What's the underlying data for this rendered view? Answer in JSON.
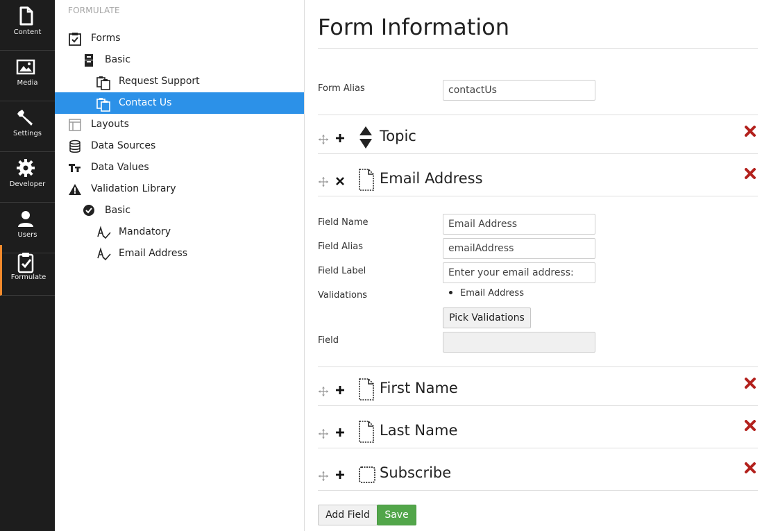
{
  "rail": {
    "items": [
      {
        "label": "Content",
        "icon": "document-icon"
      },
      {
        "label": "Media",
        "icon": "image-icon"
      },
      {
        "label": "Settings",
        "icon": "wrench-icon"
      },
      {
        "label": "Developer",
        "icon": "gear-icon"
      },
      {
        "label": "Users",
        "icon": "user-icon"
      },
      {
        "label": "Formulate",
        "icon": "clipboard-check-icon",
        "active": true
      }
    ]
  },
  "tree": {
    "title": "FORMULATE",
    "items": [
      {
        "label": "Forms",
        "icon": "clipboard-check-icon"
      },
      {
        "label": "Basic",
        "icon": "file-cabinet-icon"
      },
      {
        "label": "Request Support",
        "icon": "form-icon"
      },
      {
        "label": "Contact Us",
        "icon": "form-icon",
        "selected": true
      },
      {
        "label": "Layouts",
        "icon": "layout-icon"
      },
      {
        "label": "Data Sources",
        "icon": "database-icon"
      },
      {
        "label": "Data Values",
        "icon": "text-size-icon"
      },
      {
        "label": "Validation Library",
        "icon": "warning-icon"
      },
      {
        "label": "Basic",
        "icon": "check-circle-icon"
      },
      {
        "label": "Mandatory",
        "icon": "validation-icon"
      },
      {
        "label": "Email Address",
        "icon": "validation-icon"
      }
    ]
  },
  "main": {
    "title": "Form Information",
    "form_alias_label": "Form Alias",
    "form_alias_value": "contactUs",
    "fields": [
      {
        "name": "Topic",
        "icon": "sort-icon",
        "expanded": false
      },
      {
        "name": "Email Address",
        "icon": "text-field-icon",
        "expanded": true
      },
      {
        "name": "First Name",
        "icon": "text-field-icon",
        "expanded": false
      },
      {
        "name": "Last Name",
        "icon": "text-field-icon",
        "expanded": false
      },
      {
        "name": "Subscribe",
        "icon": "checkbox-icon",
        "expanded": false
      }
    ],
    "expanded_field": {
      "field_name_label": "Field Name",
      "field_name_value": "Email Address",
      "field_alias_label": "Field Alias",
      "field_alias_value": "emailAddress",
      "field_label_label": "Field Label",
      "field_label_value": "Enter your email address:",
      "validations_label": "Validations",
      "validations": [
        "Email Address"
      ],
      "pick_validations_label": "Pick Validations",
      "field_label": "Field",
      "field_value": ""
    },
    "add_field_label": "Add Field",
    "save_label": "Save"
  },
  "colors": {
    "rail_bg": "#1d1d1d",
    "rail_active_accent": "#f58a2c",
    "selected_bg": "#2c91e8",
    "save_bg": "#52a64a",
    "delete_red": "#c0392b"
  }
}
